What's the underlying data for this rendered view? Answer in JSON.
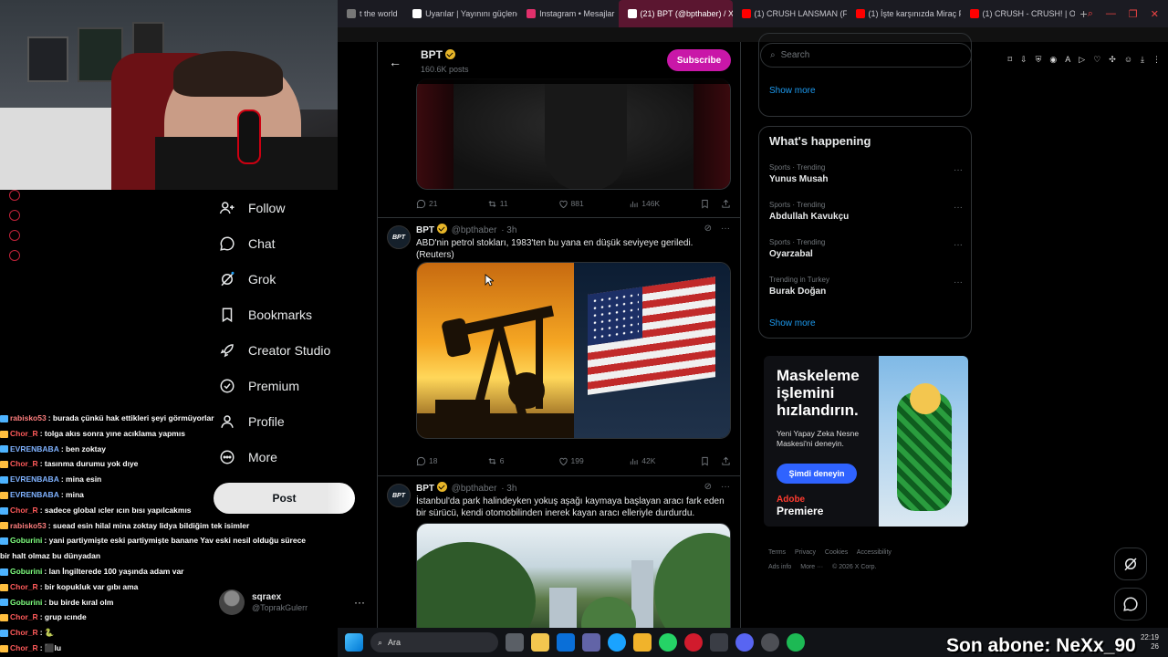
{
  "browser": {
    "tabs": [
      {
        "label": "t the world",
        "color": "#777777",
        "active": false
      },
      {
        "label": "Uyarılar | Yayınını güçlendir",
        "color": "#ffffff",
        "active": false
      },
      {
        "label": "Instagram • Mesajlar",
        "color": "#e1306c",
        "active": false
      },
      {
        "label": "(21) BPT (@bpthaber) / X",
        "color": "#ffffff",
        "active": true
      },
      {
        "label": "(1) CRUSH LANSMAN (Fa",
        "color": "#ff0000",
        "active": false
      },
      {
        "label": "(1) İşte karşınızda Miraç F",
        "color": "#ff0000",
        "active": false
      },
      {
        "label": "(1) CRUSH - CRUSH! | Offi",
        "color": "#ff0000",
        "active": false
      }
    ],
    "new_tab": "+"
  },
  "nav": {
    "items": [
      {
        "label": "Follow",
        "icon": "follow-icon"
      },
      {
        "label": "Chat",
        "icon": "chat-icon"
      },
      {
        "label": "Grok",
        "icon": "grok-icon"
      },
      {
        "label": "Bookmarks",
        "icon": "bookmark-icon"
      },
      {
        "label": "Creator Studio",
        "icon": "rocket-icon"
      },
      {
        "label": "Premium",
        "icon": "premium-icon"
      },
      {
        "label": "Profile",
        "icon": "profile-icon"
      },
      {
        "label": "More",
        "icon": "more-icon"
      }
    ],
    "post_button": "Post",
    "account": {
      "name": "sqraex",
      "handle": "@ToprakGulerr"
    }
  },
  "chat": [
    {
      "user": "rabisko53",
      "msg": ": burada çünkü hak ettikleri şeyi görmüyorlar",
      "color": "#ff7f7f"
    },
    {
      "user": "Chor_R",
      "msg": ": tolga akıs sonra yıne acıklama yapmıs",
      "color": "#ff5a5a"
    },
    {
      "user": "EVRENBABA",
      "msg": ": ben zoktay",
      "color": "#7fb2ff"
    },
    {
      "user": "Chor_R",
      "msg": ": tasınma durumu yok dıye",
      "color": "#ff5a5a"
    },
    {
      "user": "EVRENBABA",
      "msg": ": mina esin",
      "color": "#7fb2ff"
    },
    {
      "user": "EVRENBABA",
      "msg": ": mina",
      "color": "#7fb2ff"
    },
    {
      "user": "Chor_R",
      "msg": ": sadece global ıсler ıcın bısı yapılcakmıs",
      "color": "#ff5a5a"
    },
    {
      "user": "rabisko53",
      "msg": ": suead esin hilal mina zoktay lidya bildiğim tek isimler",
      "color": "#ff7f7f"
    },
    {
      "user": "Goburini",
      "msg": ": yani partiymişte eski partiymişte banane Yav eski nesil olduğu sürece",
      "color": "#7fff7f"
    },
    {
      "user": "",
      "msg": "bir halt olmaz bu dünyadan",
      "color": "#ffffff"
    },
    {
      "user": "Goburini",
      "msg": ": lan İngilterede 100 yaşında adam var",
      "color": "#7fff7f"
    },
    {
      "user": "Chor_R",
      "msg": ": bir kopukluk var gıbı ama",
      "color": "#ff5a5a"
    },
    {
      "user": "Goburini",
      "msg": ": bu birde kıral olm",
      "color": "#7fff7f"
    },
    {
      "user": "Chor_R",
      "msg": ": grup ıcınde",
      "color": "#ff5a5a"
    },
    {
      "user": "Chor_R",
      "msg": ": 🐍",
      "color": "#ff5a5a"
    },
    {
      "user": "Chor_R",
      "msg": ": ⬛lu",
      "color": "#ff5a5a"
    }
  ],
  "timeline": {
    "header": {
      "name": "BPT",
      "posts": "160.6K posts",
      "subscribe": "Subscribe"
    },
    "post1_stats": {
      "replies": "21",
      "reposts": "11",
      "likes": "881",
      "views": "146K"
    },
    "post2": {
      "avatar": "BPT",
      "name": "BPT",
      "handle": "@bpthaber",
      "time": "· 3h",
      "text": "ABD'nin petrol stokları, 1983'ten bu yana en düşük seviyeye geriledi. (Reuters)",
      "stats": {
        "replies": "18",
        "reposts": "6",
        "likes": "199",
        "views": "42K"
      }
    },
    "post3": {
      "avatar": "BPT",
      "name": "BPT",
      "handle": "@bpthaber",
      "time": "· 3h",
      "text": "İstanbul'da park halindeyken yokuş aşağı kaymaya başlayan aracı fark eden bir sürücü, kendi otomobilinden inerek kayan aracı elleriyle durdurdu."
    }
  },
  "sidebar": {
    "search_placeholder": "Search",
    "show_more_1": "Show more",
    "whats_happening": "What's happening",
    "trends": [
      {
        "meta": "Sports · Trending",
        "topic": "Yunus Musah"
      },
      {
        "meta": "Sports · Trending",
        "topic": "Abdullah Kavukçu"
      },
      {
        "meta": "Sports · Trending",
        "topic": "Oyarzabal"
      },
      {
        "meta": "Trending in Turkey",
        "topic": "Burak Doğan"
      }
    ],
    "show_more_2": "Show more",
    "ad": {
      "headline": "Maskeleme işlemini hızlandırın.",
      "sub": "Yeni Yapay Zeka Nesne Maskesi'ni deneyin.",
      "cta": "Şimdi deneyin",
      "brand_top": "Adobe",
      "brand_bottom": "Premiere"
    },
    "footer": [
      "Terms",
      "Privacy",
      "Cookies",
      "Accessibility",
      "Ads info",
      "More ···",
      "© 2026 X Corp."
    ]
  },
  "taskbar": {
    "search": "Ara",
    "time": "22:19",
    "date": "26"
  },
  "overlay": {
    "abone": "Son abone: NeXx_90"
  }
}
